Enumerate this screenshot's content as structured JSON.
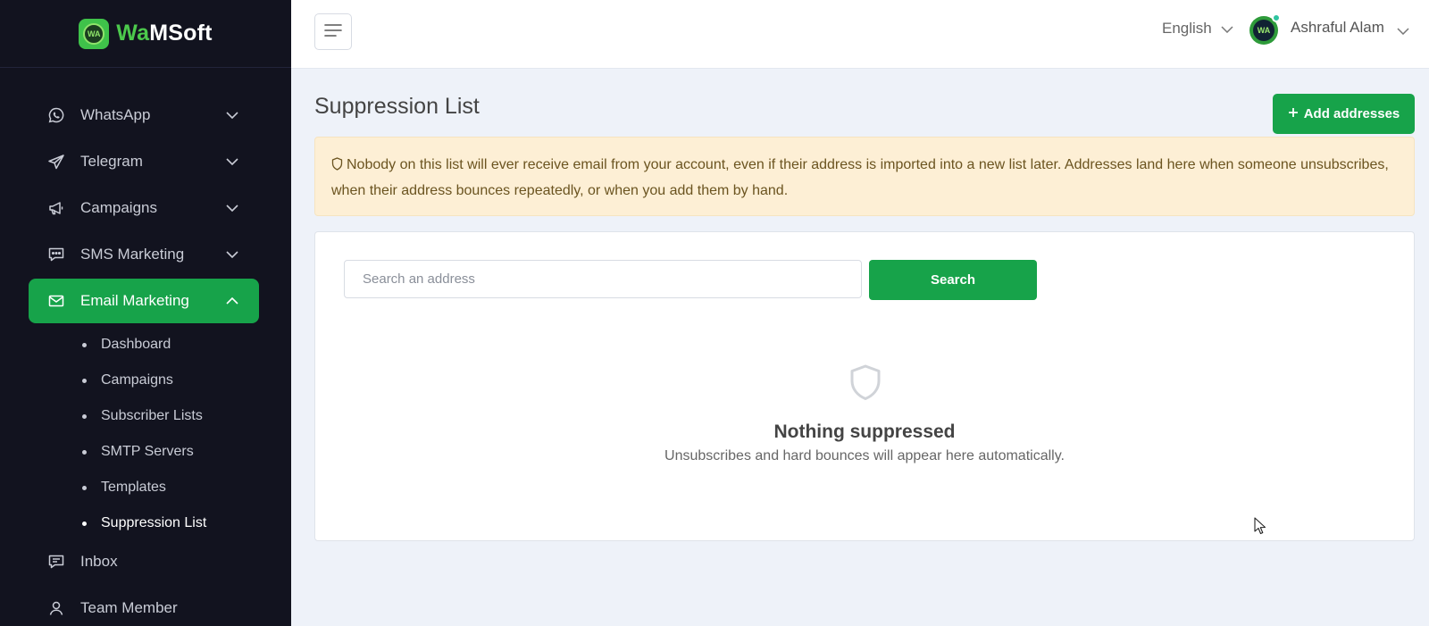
{
  "brand": {
    "name_accent": "Wa",
    "name_rest": "MSoft",
    "logo_text": "WA"
  },
  "sidebar": {
    "items": [
      {
        "label": "WhatsApp",
        "icon": "whatsapp-icon",
        "expanded": false
      },
      {
        "label": "Telegram",
        "icon": "telegram-icon",
        "expanded": false
      },
      {
        "label": "Campaigns",
        "icon": "megaphone-icon",
        "expanded": false
      },
      {
        "label": "SMS Marketing",
        "icon": "sms-icon",
        "expanded": false
      },
      {
        "label": "Email Marketing",
        "icon": "mail-icon",
        "expanded": true,
        "active": true
      },
      {
        "label": "Inbox",
        "icon": "inbox-icon"
      },
      {
        "label": "Team Member",
        "icon": "user-icon"
      }
    ],
    "email_sub": [
      "Dashboard",
      "Campaigns",
      "Subscriber Lists",
      "SMTP Servers",
      "Templates",
      "Suppression List"
    ],
    "email_sub_current": "Suppression List"
  },
  "topbar": {
    "language": "English",
    "user_name": "Ashraful Alam",
    "avatar_text": "WA"
  },
  "page": {
    "title": "Suppression List",
    "add_button_label": "Add addresses",
    "notice": "Nobody on this list will ever receive email from your account, even if their address is imported into a new list later. Addresses land here when someone unsubscribes, when their address bounces repeatedly, or when you add them by hand.",
    "search_placeholder": "Search an address",
    "search_button_label": "Search",
    "empty_title": "Nothing suppressed",
    "empty_subtitle": "Unsubscribes and hard bounces will appear here automatically."
  },
  "colors": {
    "sidebar_bg": "#12131f",
    "accent_green": "#17a34a",
    "notice_bg": "#fdefd5",
    "content_bg": "#eef2f9"
  }
}
